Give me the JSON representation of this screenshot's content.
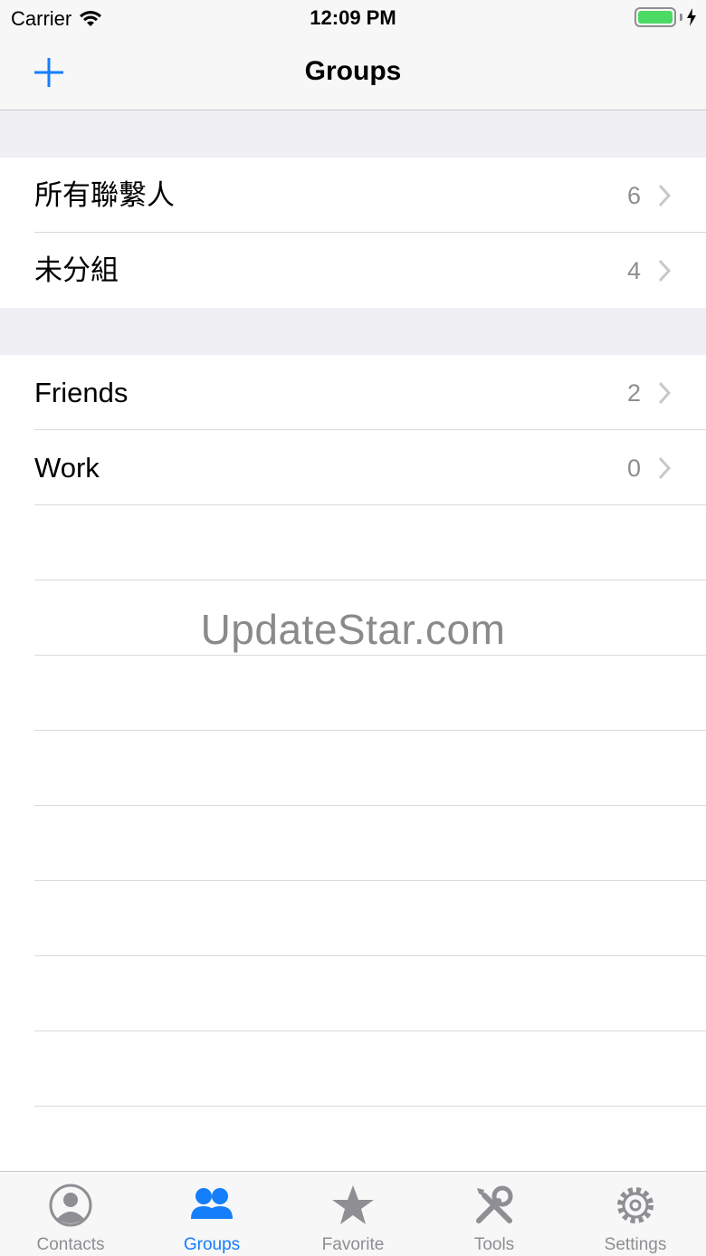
{
  "status_bar": {
    "carrier": "Carrier",
    "time": "12:09 PM"
  },
  "nav": {
    "title": "Groups",
    "add_icon": "plus-icon"
  },
  "sections": [
    {
      "rows": [
        {
          "label": "所有聯繫人",
          "count": "6"
        },
        {
          "label": "未分組",
          "count": "4"
        }
      ]
    },
    {
      "rows": [
        {
          "label": "Friends",
          "count": "2"
        },
        {
          "label": "Work",
          "count": "0"
        }
      ]
    }
  ],
  "watermark": "UpdateStar.com",
  "tabs": [
    {
      "label": "Contacts",
      "icon": "person-circle-icon",
      "active": false
    },
    {
      "label": "Groups",
      "icon": "groups-icon",
      "active": true
    },
    {
      "label": "Favorite",
      "icon": "star-icon",
      "active": false
    },
    {
      "label": "Tools",
      "icon": "tools-icon",
      "active": false
    },
    {
      "label": "Settings",
      "icon": "gear-icon",
      "active": false
    }
  ],
  "colors": {
    "accent": "#147efb",
    "inactive": "#8e8e93",
    "battery": "#4cd964",
    "group_bg": "#efeff4"
  }
}
